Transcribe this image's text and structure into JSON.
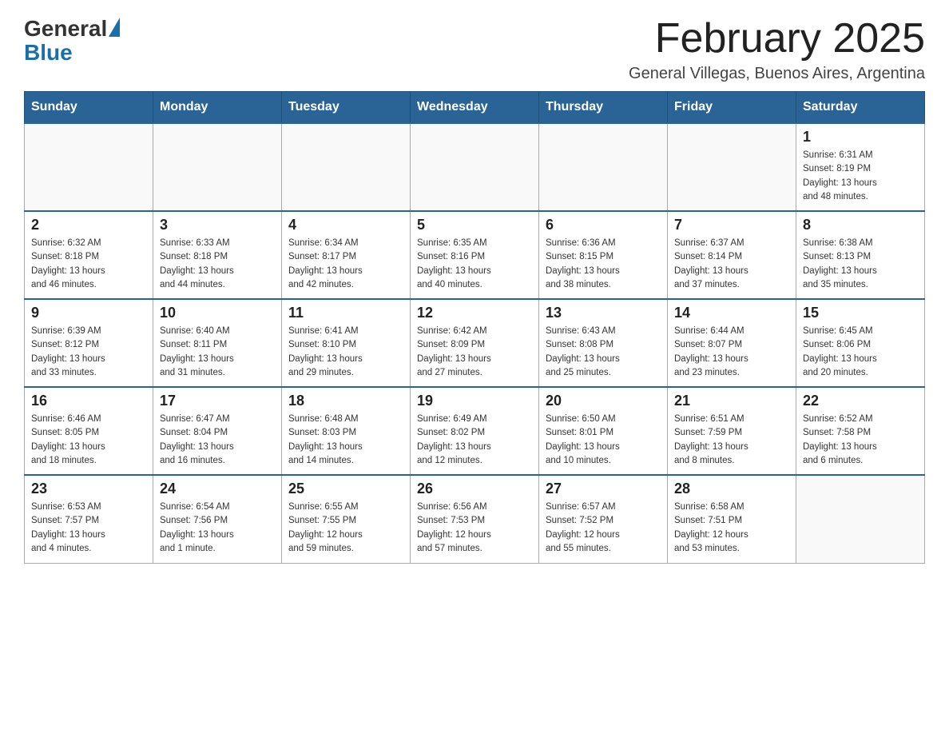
{
  "logo": {
    "general": "General",
    "blue": "Blue"
  },
  "title": "February 2025",
  "location": "General Villegas, Buenos Aires, Argentina",
  "weekdays": [
    "Sunday",
    "Monday",
    "Tuesday",
    "Wednesday",
    "Thursday",
    "Friday",
    "Saturday"
  ],
  "weeks": [
    [
      {
        "day": "",
        "info": ""
      },
      {
        "day": "",
        "info": ""
      },
      {
        "day": "",
        "info": ""
      },
      {
        "day": "",
        "info": ""
      },
      {
        "day": "",
        "info": ""
      },
      {
        "day": "",
        "info": ""
      },
      {
        "day": "1",
        "info": "Sunrise: 6:31 AM\nSunset: 8:19 PM\nDaylight: 13 hours\nand 48 minutes."
      }
    ],
    [
      {
        "day": "2",
        "info": "Sunrise: 6:32 AM\nSunset: 8:18 PM\nDaylight: 13 hours\nand 46 minutes."
      },
      {
        "day": "3",
        "info": "Sunrise: 6:33 AM\nSunset: 8:18 PM\nDaylight: 13 hours\nand 44 minutes."
      },
      {
        "day": "4",
        "info": "Sunrise: 6:34 AM\nSunset: 8:17 PM\nDaylight: 13 hours\nand 42 minutes."
      },
      {
        "day": "5",
        "info": "Sunrise: 6:35 AM\nSunset: 8:16 PM\nDaylight: 13 hours\nand 40 minutes."
      },
      {
        "day": "6",
        "info": "Sunrise: 6:36 AM\nSunset: 8:15 PM\nDaylight: 13 hours\nand 38 minutes."
      },
      {
        "day": "7",
        "info": "Sunrise: 6:37 AM\nSunset: 8:14 PM\nDaylight: 13 hours\nand 37 minutes."
      },
      {
        "day": "8",
        "info": "Sunrise: 6:38 AM\nSunset: 8:13 PM\nDaylight: 13 hours\nand 35 minutes."
      }
    ],
    [
      {
        "day": "9",
        "info": "Sunrise: 6:39 AM\nSunset: 8:12 PM\nDaylight: 13 hours\nand 33 minutes."
      },
      {
        "day": "10",
        "info": "Sunrise: 6:40 AM\nSunset: 8:11 PM\nDaylight: 13 hours\nand 31 minutes."
      },
      {
        "day": "11",
        "info": "Sunrise: 6:41 AM\nSunset: 8:10 PM\nDaylight: 13 hours\nand 29 minutes."
      },
      {
        "day": "12",
        "info": "Sunrise: 6:42 AM\nSunset: 8:09 PM\nDaylight: 13 hours\nand 27 minutes."
      },
      {
        "day": "13",
        "info": "Sunrise: 6:43 AM\nSunset: 8:08 PM\nDaylight: 13 hours\nand 25 minutes."
      },
      {
        "day": "14",
        "info": "Sunrise: 6:44 AM\nSunset: 8:07 PM\nDaylight: 13 hours\nand 23 minutes."
      },
      {
        "day": "15",
        "info": "Sunrise: 6:45 AM\nSunset: 8:06 PM\nDaylight: 13 hours\nand 20 minutes."
      }
    ],
    [
      {
        "day": "16",
        "info": "Sunrise: 6:46 AM\nSunset: 8:05 PM\nDaylight: 13 hours\nand 18 minutes."
      },
      {
        "day": "17",
        "info": "Sunrise: 6:47 AM\nSunset: 8:04 PM\nDaylight: 13 hours\nand 16 minutes."
      },
      {
        "day": "18",
        "info": "Sunrise: 6:48 AM\nSunset: 8:03 PM\nDaylight: 13 hours\nand 14 minutes."
      },
      {
        "day": "19",
        "info": "Sunrise: 6:49 AM\nSunset: 8:02 PM\nDaylight: 13 hours\nand 12 minutes."
      },
      {
        "day": "20",
        "info": "Sunrise: 6:50 AM\nSunset: 8:01 PM\nDaylight: 13 hours\nand 10 minutes."
      },
      {
        "day": "21",
        "info": "Sunrise: 6:51 AM\nSunset: 7:59 PM\nDaylight: 13 hours\nand 8 minutes."
      },
      {
        "day": "22",
        "info": "Sunrise: 6:52 AM\nSunset: 7:58 PM\nDaylight: 13 hours\nand 6 minutes."
      }
    ],
    [
      {
        "day": "23",
        "info": "Sunrise: 6:53 AM\nSunset: 7:57 PM\nDaylight: 13 hours\nand 4 minutes."
      },
      {
        "day": "24",
        "info": "Sunrise: 6:54 AM\nSunset: 7:56 PM\nDaylight: 13 hours\nand 1 minute."
      },
      {
        "day": "25",
        "info": "Sunrise: 6:55 AM\nSunset: 7:55 PM\nDaylight: 12 hours\nand 59 minutes."
      },
      {
        "day": "26",
        "info": "Sunrise: 6:56 AM\nSunset: 7:53 PM\nDaylight: 12 hours\nand 57 minutes."
      },
      {
        "day": "27",
        "info": "Sunrise: 6:57 AM\nSunset: 7:52 PM\nDaylight: 12 hours\nand 55 minutes."
      },
      {
        "day": "28",
        "info": "Sunrise: 6:58 AM\nSunset: 7:51 PM\nDaylight: 12 hours\nand 53 minutes."
      },
      {
        "day": "",
        "info": ""
      }
    ]
  ]
}
